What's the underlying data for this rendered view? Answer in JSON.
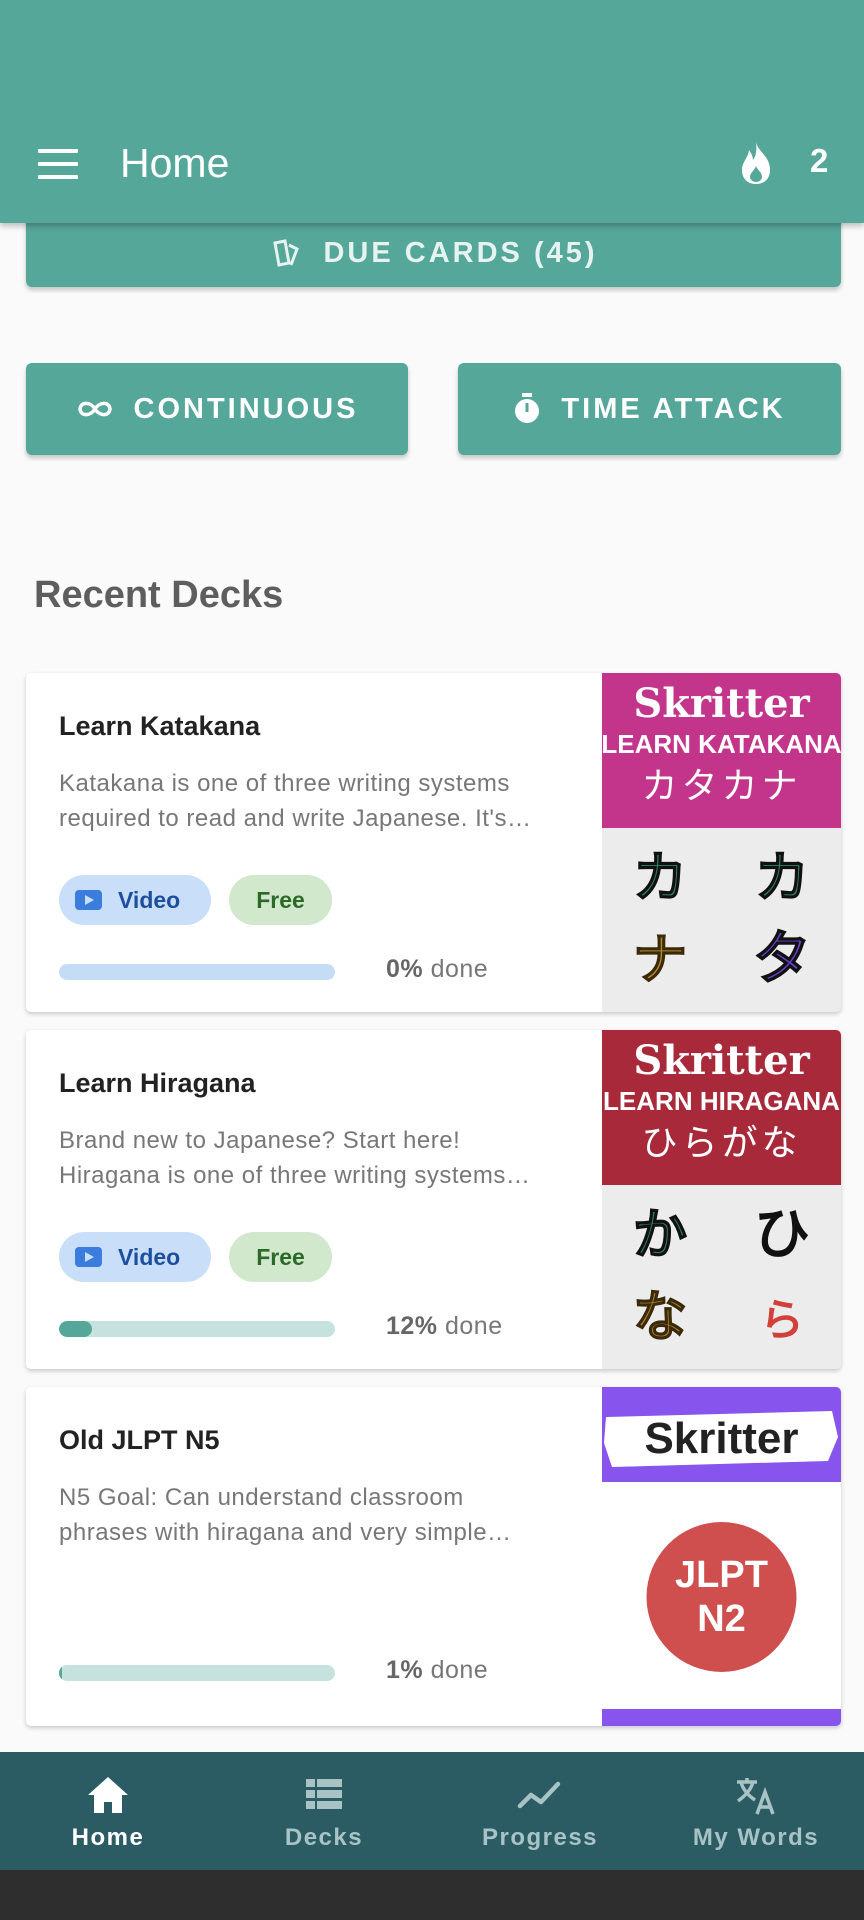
{
  "appbar": {
    "title": "Home",
    "streak_count": "2"
  },
  "actions": {
    "due_cards": "DUE CARDS (45)",
    "continuous": "CONTINUOUS",
    "time_attack": "TIME ATTACK"
  },
  "recent_decks": {
    "title": "Recent Decks",
    "items": [
      {
        "title": "Learn Katakana",
        "desc_line1": "Katakana is one of three writing systems",
        "desc_line2": "required to read and write Japanese. It's…",
        "badge_video": "Video",
        "badge_free": "Free",
        "progress_percent": 0,
        "progress_value": "0%",
        "progress_suffix": " done",
        "image": {
          "brand": "Skritter",
          "line1": "LEARN KATAKANA",
          "line2": "カタカナ",
          "color": "#c2358a",
          "chars": [
            "カ",
            "カ",
            "ナ",
            "タ"
          ]
        }
      },
      {
        "title": "Learn Hiragana",
        "desc_line1": "Brand new to Japanese? Start here!",
        "desc_line2": "Hiragana is one of three writing systems…",
        "badge_video": "Video",
        "badge_free": "Free",
        "progress_percent": 12,
        "progress_value": "12%",
        "progress_suffix": " done",
        "image": {
          "brand": "Skritter",
          "line1": "LEARN HIRAGANA",
          "line2": "ひらがな",
          "color": "#a82a3a",
          "chars": [
            "か",
            "ひ",
            "な",
            "ら"
          ]
        }
      },
      {
        "title": "Old JLPT N5",
        "desc_line1": "N5 Goal: Can understand classroom",
        "desc_line2": "phrases with hiragana and very simple…",
        "progress_percent": 1,
        "progress_value": "1%",
        "progress_suffix": " done",
        "image": {
          "brand": "Skritter",
          "badge_line1": "JLPT",
          "badge_line2": "N2",
          "color": "#8754ee",
          "badge_color": "#cf4e4e"
        }
      }
    ]
  },
  "bottom_nav": {
    "items": [
      {
        "label": "Home",
        "icon": "home-icon",
        "active": true
      },
      {
        "label": "Decks",
        "icon": "list-icon",
        "active": false
      },
      {
        "label": "Progress",
        "icon": "trend-icon",
        "active": false
      },
      {
        "label": "My Words",
        "icon": "translate-icon",
        "active": false
      }
    ]
  },
  "colors": {
    "primary": "#55a79a",
    "nav": "#2b5c63",
    "background": "#fafafa"
  }
}
